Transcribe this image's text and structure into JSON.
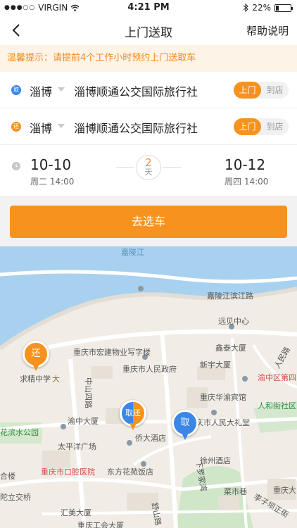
{
  "status_bar": {
    "signal_dots": "●●●○○",
    "carrier": "VIRGIN",
    "time": "4:21 PM",
    "battery_pct": "22%",
    "battery_level": 0.22
  },
  "nav": {
    "title": "上门送取",
    "help": "帮助说明"
  },
  "tip": "温馨提示：请提前4个工作小时预约上门送取车",
  "pickup": {
    "badge": "取",
    "city": "淄博",
    "store": "淄博顺通公交国际旅行社",
    "opt_door": "上门",
    "opt_store": "到店",
    "active": "上门"
  },
  "return": {
    "badge": "还",
    "city": "淄博",
    "store": "淄博顺通公交国际旅行社",
    "opt_door": "上门",
    "opt_store": "到店",
    "active": "上门"
  },
  "dates": {
    "pick_date": "10-10",
    "pick_time": "周二 14:00",
    "ret_date": "10-12",
    "ret_time": "周四 14:00",
    "duration_num": "2",
    "duration_unit": "天"
  },
  "cta": "去选车",
  "colors": {
    "accent": "#f7921e",
    "blue": "#3c87e6",
    "tip_bg": "#fdf3e6"
  },
  "map": {
    "labels": {
      "jialing": "嘉陵江",
      "jialing_road": "嘉陵江滨江路",
      "yuanjian": "远见中心",
      "xintai": "鑫泰大厦",
      "hongjian": "重庆市宏建物业写字楼",
      "gov": "重庆市人民政府",
      "xinyu": "新宇大厦",
      "renmin_road": "人民路",
      "yuzhong_district": "渝中区第四",
      "qiujing": "求精中学",
      "huayu": "重庆华渝宾馆",
      "renhe": "人和街社区",
      "zhongshan": "中山四路",
      "yuzhong_tower": "渝中大厦",
      "renmin_hall": "庆市人民大礼堂",
      "binjiang_park": "花滨水公园",
      "qiaoda": "侨大酒店",
      "taiping": "太平洋广场",
      "xuzhou": "徐州酒店",
      "kouqiang": "重庆市口腔医院",
      "dongfang": "东方花苑饭店",
      "xialuo": "下罗家湾",
      "caiyuan": "菜市巷",
      "chongqing_tower": "重庆大",
      "lizi": "李子坝正街",
      "shilou": "合楼",
      "tuolijiao": "陀立交桥",
      "huimei": "汇美大厦",
      "gonghui": "重庆工会大厦",
      "shanhu": "舒山路",
      "qiujing_badge": "大"
    },
    "pins": {
      "return_pin": "还",
      "pickup_pin": "取",
      "split_left": "取",
      "split_right": "还"
    }
  }
}
